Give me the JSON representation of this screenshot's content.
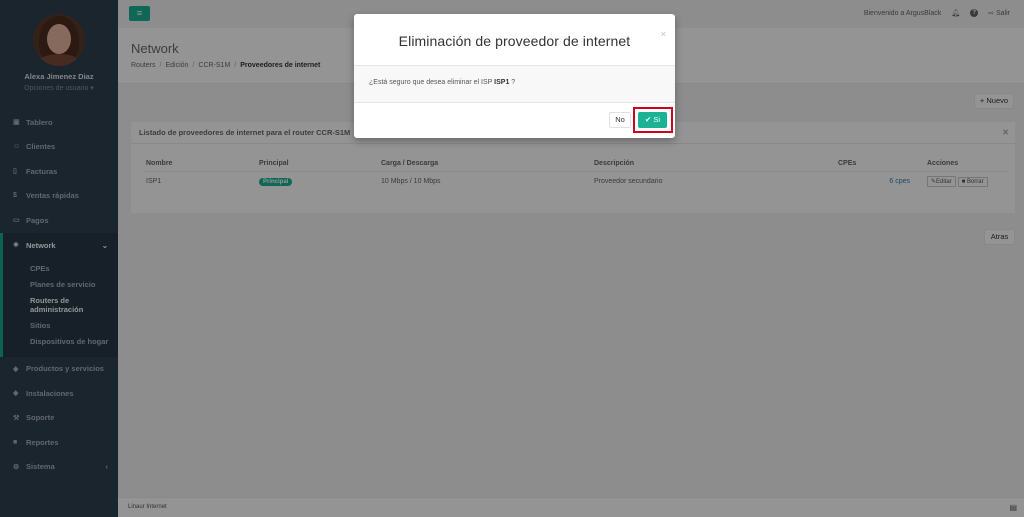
{
  "user": {
    "name": "Alexa Jimenez Diaz",
    "options": "Opciones de usuario ▾"
  },
  "sidebar": {
    "items": [
      {
        "label": "Tablero",
        "icon": "dashboard-icon",
        "glyph": "▣"
      },
      {
        "label": "Clientes",
        "icon": "users-icon",
        "glyph": "☺"
      },
      {
        "label": "Facturas",
        "icon": "file-icon",
        "glyph": "▯"
      },
      {
        "label": "Ventas rápidas",
        "icon": "dollar-icon",
        "glyph": "$"
      },
      {
        "label": "Pagos",
        "icon": "money-icon",
        "glyph": "▭"
      }
    ],
    "network": {
      "label": "Network",
      "glyph": "✳",
      "chevron": "⌄"
    },
    "network_sub": [
      "CPEs",
      "Planes de servicio",
      "Routers de administración",
      "Sitios",
      "Dispositivos de hogar"
    ],
    "items_after": [
      {
        "label": "Productos y servicios",
        "icon": "tag-icon",
        "glyph": "◆"
      },
      {
        "label": "Instalaciones",
        "icon": "tools-icon",
        "glyph": "◆"
      },
      {
        "label": "Soporte",
        "icon": "wrench-icon",
        "glyph": "⚒"
      },
      {
        "label": "Reportes",
        "icon": "book-icon",
        "glyph": "■"
      },
      {
        "label": "Sistema",
        "icon": "cogs-icon",
        "glyph": "⚙",
        "chevron": "‹"
      }
    ]
  },
  "topbar": {
    "menu_glyph": "≡",
    "welcome": "Bienvenido a ArgusBlack",
    "logout": "Salir"
  },
  "heading": {
    "title": "Network",
    "breadcrumb": [
      "Routers",
      "Edición",
      "CCR-S1M",
      "Proveedores de internet"
    ]
  },
  "buttons": {
    "new": "+ Nuevo",
    "back": "Atras"
  },
  "panel": {
    "title": "Listado de proveedores de internet para el router CCR-S1M",
    "columns": [
      "Nombre",
      "Principal",
      "Carga / Descarga",
      "Descripción",
      "CPEs",
      "Acciones"
    ],
    "rows": [
      {
        "name": "ISP1",
        "principal": "Principal",
        "speed": "10 Mbps / 10 Mbps",
        "description": "Proveedor secundario",
        "cpes": "6 cpes",
        "edit": "Editar",
        "delete": "Borrar"
      }
    ]
  },
  "footer": {
    "text": "Linaur Internet"
  },
  "modal": {
    "title": "Eliminación de proveedor de internet",
    "body_prefix": "¿Está seguro que desea eliminar el ISP ",
    "isp": "ISP1",
    "body_suffix": " ?",
    "no": "No",
    "yes": "Si"
  },
  "colors": {
    "accent": "#1ab394",
    "sidebar": "#2f4050",
    "highlight": "#d0021b"
  }
}
